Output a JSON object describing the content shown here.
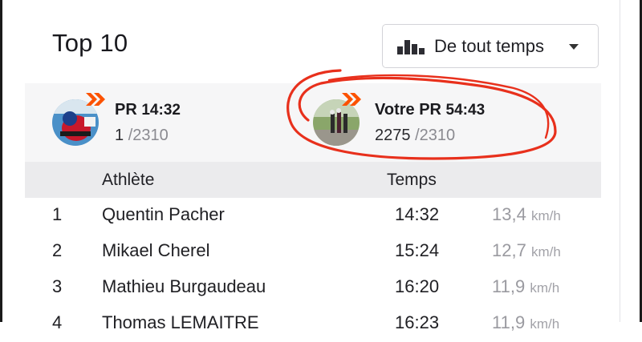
{
  "header": {
    "title": "Top 10",
    "filter": {
      "label": "De tout temps",
      "icon": "bar-chart-icon",
      "caret": "caret-down-icon"
    }
  },
  "summary": {
    "leader": {
      "label": "PR",
      "time": "14:32",
      "rank": "1",
      "total": "/2310",
      "avatar": "cyclist-avatar"
    },
    "you": {
      "label": "Votre PR",
      "time": "54:43",
      "rank": "2275",
      "total": "/2310",
      "avatar": "group-ride-avatar"
    }
  },
  "table": {
    "headers": {
      "athlete": "Athlète",
      "time": "Temps"
    },
    "rows": [
      {
        "rank": "1",
        "name": "Quentin Pacher",
        "time": "14:32",
        "speed": "13,4",
        "unit": "km/h"
      },
      {
        "rank": "2",
        "name": "Mikael Cherel",
        "time": "15:24",
        "speed": "12,7",
        "unit": "km/h"
      },
      {
        "rank": "3",
        "name": "Mathieu Burgaudeau",
        "time": "16:20",
        "speed": "11,9",
        "unit": "km/h"
      },
      {
        "rank": "4",
        "name": "Thomas LEMAITRE",
        "time": "16:23",
        "speed": "11,9",
        "unit": "km/h"
      }
    ]
  },
  "colors": {
    "accent": "#fc5200",
    "annotation": "#e8301c"
  }
}
